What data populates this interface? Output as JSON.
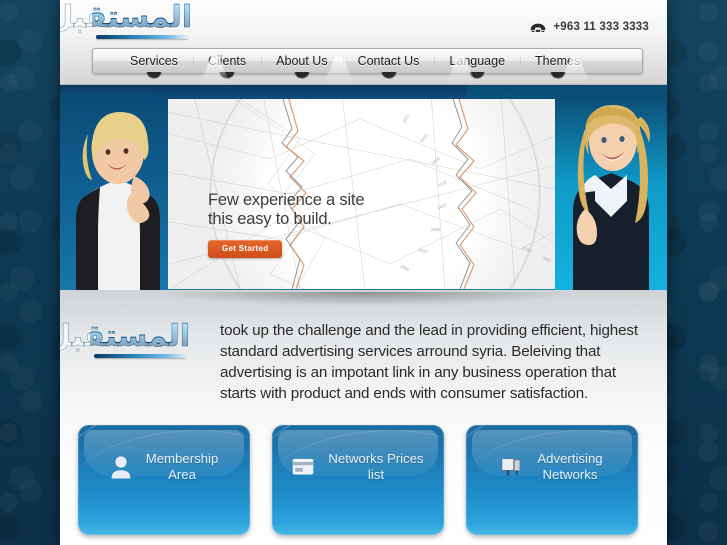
{
  "header": {
    "logo_text": "المستقبل",
    "logo_name": "al-mustaqbal-logo",
    "phone": "+963 11 333 3333",
    "phone_icon": "telephone-icon",
    "nav": [
      {
        "label": "Services"
      },
      {
        "label": "Clients"
      },
      {
        "label": "About Us"
      },
      {
        "label": "Contact Us"
      },
      {
        "label": "Language"
      },
      {
        "label": "Themes"
      }
    ]
  },
  "hero": {
    "headline_line1": "Few experience a site",
    "headline_line2": "this easy to build.",
    "cta_label": "Get Started",
    "cta_color": "#d4521b",
    "panel_bg": "#efefef",
    "bg_blue": "#1b8cc4",
    "bg_cyan": "#14b0dd",
    "left_photo": "smiling-woman-photo",
    "right_photo": "smiling-businesswoman-photo"
  },
  "content": {
    "logo_text": "المستقبل",
    "intro": "took up the challenge and the lead in providing efficient, highest standard advertising services arround syria. Beleiving that advertising is an impotant link in any business operation that starts with product and ends with consumer satisfaction.",
    "cards": [
      {
        "label_line1": "Membership",
        "label_line2": "Area",
        "icon": "user-icon",
        "name": "membership-area-card"
      },
      {
        "label_line1": "Networks Prices",
        "label_line2": "list",
        "icon": "credit-card-icon",
        "name": "networks-prices-list-card"
      },
      {
        "label_line1": "Advertising",
        "label_line2": "Networks",
        "icon": "billboard-icon",
        "name": "advertising-networks-card"
      }
    ]
  },
  "theme": {
    "page_bg": "#0e3a55",
    "header_bg": "#f1f1f1",
    "card_blue": "#1e8cc9",
    "logo_blue": "#2f8ec9"
  }
}
